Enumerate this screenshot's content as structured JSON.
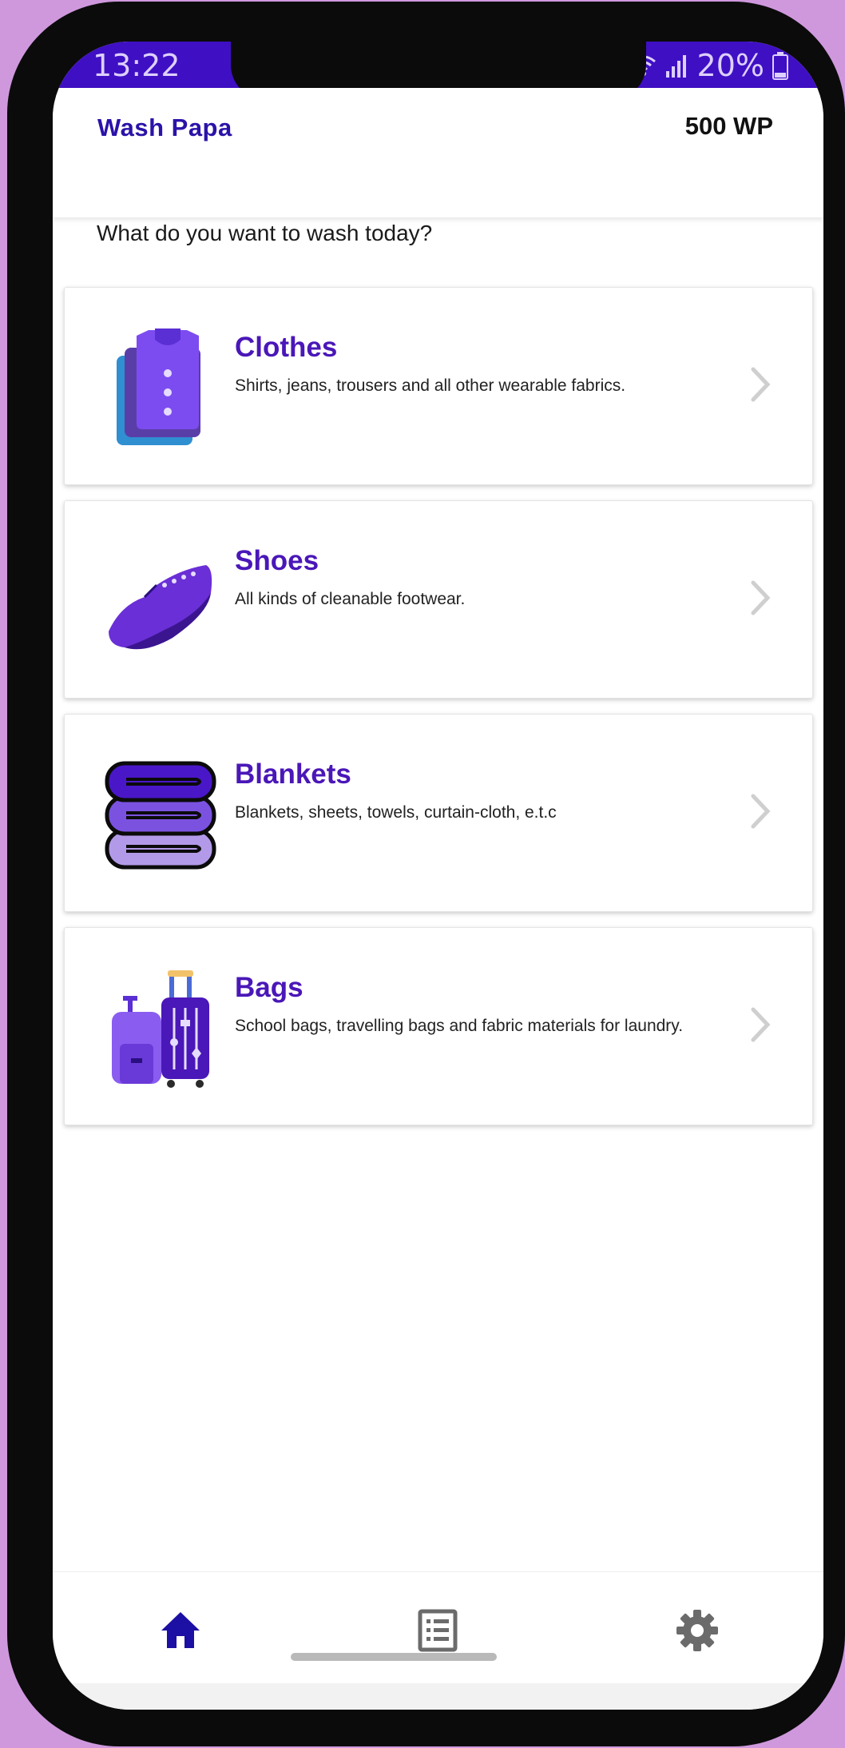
{
  "status_bar": {
    "time": "13:22",
    "battery": "20%",
    "icons": [
      "wifi-icon",
      "signal-icon",
      "battery-icon"
    ]
  },
  "app_bar": {
    "title": "Wash Papa",
    "balance": "500 WP"
  },
  "prompt": "What do you want to wash today?",
  "categories": [
    {
      "title": "Clothes",
      "description": "Shirts, jeans, trousers and all other wearable fabrics.",
      "icon": "shirt-stack-icon"
    },
    {
      "title": "Shoes",
      "description": "All kinds of cleanable footwear.",
      "icon": "shoe-icon"
    },
    {
      "title": "Blankets",
      "description": "Blankets, sheets, towels, curtain-cloth, e.t.c",
      "icon": "folded-blankets-icon"
    },
    {
      "title": "Bags",
      "description": "School bags, travelling bags and fabric materials for laundry.",
      "icon": "luggage-icon"
    }
  ],
  "bottom_nav": {
    "items": [
      "home-icon",
      "orders-list-icon",
      "settings-gear-icon"
    ],
    "active": "home-icon"
  },
  "colors": {
    "status_bar": "#3f0fc4",
    "brand": "#2a13a8",
    "card_title": "#4a17b8",
    "nav_active": "#1c0fa3",
    "nav_inactive": "#6b6b6b"
  }
}
